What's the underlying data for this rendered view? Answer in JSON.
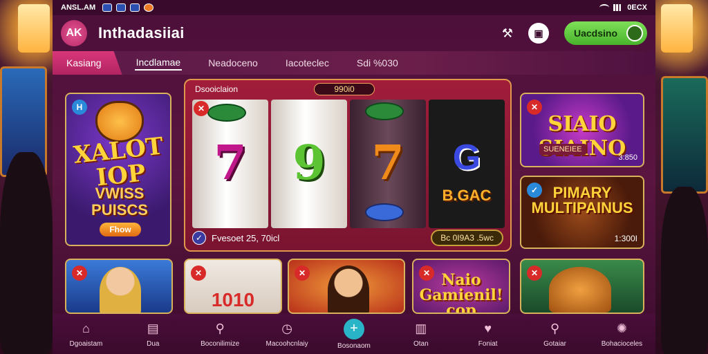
{
  "status_bar": {
    "time": "ANSL.AM",
    "right": "0ECX"
  },
  "header": {
    "avatar_initials": "AK",
    "title": "Inthadasiiai",
    "cta_label": "Uacdsino"
  },
  "tabs": [
    {
      "label": "Kasiang"
    },
    {
      "label": "Incdlamae"
    },
    {
      "label": "Neadoceno"
    },
    {
      "label": "Iacoteclec"
    },
    {
      "label": "Sdi %030"
    }
  ],
  "slot": {
    "title": "Dsooiclaion",
    "jackpot": "990i0",
    "bet_text": "Fvesoet 25, 70icl",
    "balance": "Bc 0I9A3 .5wc",
    "reel_symbols": [
      "7",
      "9",
      "7",
      "G"
    ],
    "reel_caption": "B.GAC"
  },
  "cards": {
    "tiger": {
      "title": "XALOT IOP",
      "subtitle": "VWISS PUISCS",
      "button": "Fhow",
      "badge": "H"
    },
    "siaino": {
      "title": "SIAIO SIAINO",
      "subtitle": "SUENEIEE",
      "price": "3:850",
      "badge": "✕"
    },
    "multi": {
      "title": "PIMARY MULTIPAINUS",
      "price": "1:300I",
      "badge": "✓"
    },
    "b1": {
      "badge": "✕"
    },
    "b2": {
      "text": "1010",
      "badge": "✕"
    },
    "b3": {
      "badge": "✕"
    },
    "b4": {
      "text": "Naio Gamienil! cop",
      "badge": "✕"
    },
    "b5": {
      "badge": "✕"
    }
  },
  "bottom_nav": [
    {
      "label": "Dgoaistam",
      "icon": "home-icon"
    },
    {
      "label": "Dua",
      "icon": "wallet-icon"
    },
    {
      "label": "Boconilimize",
      "icon": "search-icon"
    },
    {
      "label": "Macoohcnlaiy",
      "icon": "clock-icon"
    },
    {
      "label": "Bosonaom",
      "icon": "plus-icon"
    },
    {
      "label": "Otan",
      "icon": "bag-icon"
    },
    {
      "label": "Foniat",
      "icon": "heart-icon"
    },
    {
      "label": "Gotaiar",
      "icon": "search-icon"
    },
    {
      "label": "Bohacioceles",
      "icon": "settings-icon"
    }
  ],
  "colors": {
    "app_bg": "#4b0f3a",
    "cta": "#5cc43a",
    "accent": "#d9377a",
    "active_nav": "#2ab4c8"
  }
}
